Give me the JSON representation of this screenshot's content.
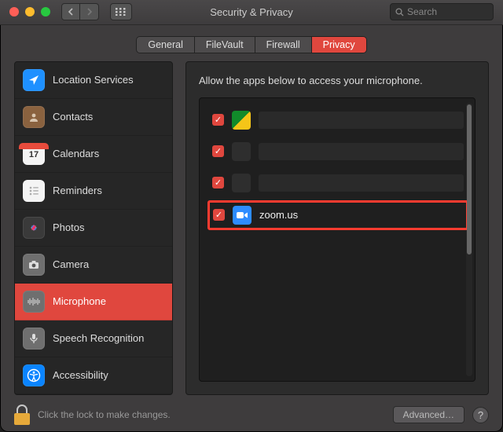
{
  "window": {
    "title": "Security & Privacy",
    "search_placeholder": "Search"
  },
  "tabs": [
    {
      "label": "General",
      "active": false
    },
    {
      "label": "FileVault",
      "active": false
    },
    {
      "label": "Firewall",
      "active": false
    },
    {
      "label": "Privacy",
      "active": true
    }
  ],
  "sidebar": {
    "items": [
      {
        "label": "Location Services",
        "icon": "location-icon",
        "bg": "#1e90ff"
      },
      {
        "label": "Contacts",
        "icon": "contacts-icon",
        "bg": "#8a623f"
      },
      {
        "label": "Calendars",
        "icon": "calendar-icon",
        "bg": "#f2f2f2",
        "badge": "17"
      },
      {
        "label": "Reminders",
        "icon": "reminders-icon",
        "bg": "#f2f2f2"
      },
      {
        "label": "Photos",
        "icon": "photos-icon",
        "bg": "#3a3a3a"
      },
      {
        "label": "Camera",
        "icon": "camera-icon",
        "bg": "#6f6f6f"
      },
      {
        "label": "Microphone",
        "icon": "microphone-icon",
        "bg": "#6f6f6f",
        "active": true
      },
      {
        "label": "Speech Recognition",
        "icon": "speech-icon",
        "bg": "#6f6f6f"
      },
      {
        "label": "Accessibility",
        "icon": "accessibility-icon",
        "bg": "#0a84ff"
      }
    ]
  },
  "main": {
    "heading": "Allow the apps below to access your microphone.",
    "apps": [
      {
        "checked": true,
        "name": "",
        "redacted": true,
        "icon_bg": "linear-gradient(135deg,#118a2a,#f5c518)"
      },
      {
        "checked": true,
        "name": "",
        "redacted": true,
        "icon_bg": "#3a3a3a"
      },
      {
        "checked": true,
        "name": "",
        "redacted": true,
        "icon_bg": "#3a3a3a"
      },
      {
        "checked": true,
        "name": "zoom.us",
        "redacted": false,
        "icon": "video-icon",
        "icon_bg": "#2d8cff",
        "highlight": true
      }
    ]
  },
  "footer": {
    "lock_text": "Click the lock to make changes.",
    "advanced_label": "Advanced…"
  }
}
